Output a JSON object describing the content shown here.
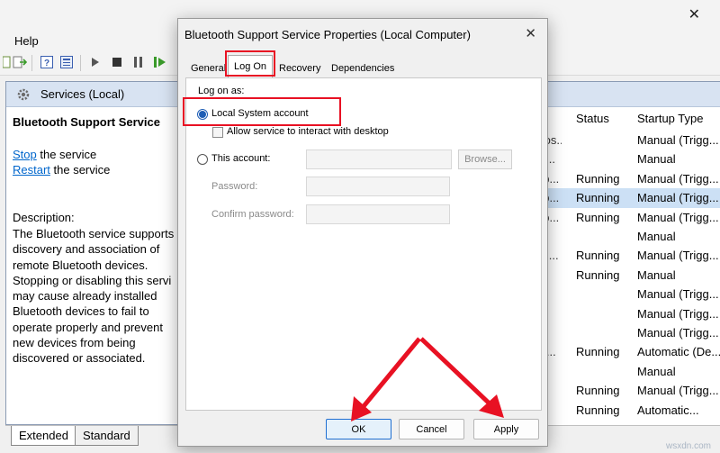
{
  "menu": {
    "help": "Help"
  },
  "left_pane": {
    "header": "Services (Local)",
    "service_name": "Bluetooth Support Service",
    "stop_link": "Stop",
    "stop_rest": " the service",
    "restart_link": "Restart",
    "restart_rest": " the service",
    "description_label": "Description:",
    "description_lines": [
      "The Bluetooth service supports",
      "discovery and association of",
      "remote Bluetooth devices.",
      "Stopping or disabling this servi",
      "may cause already installed",
      "Bluetooth devices to fail to",
      "operate properly and prevent",
      "new devices from being",
      "discovered or associated."
    ]
  },
  "services_list": {
    "headers": {
      "name_fragment": "n",
      "status": "Status",
      "startup": "Startup Type"
    },
    "rows": [
      {
        "frag": "Pos...",
        "status": "",
        "startup": "Manual (Trigg..."
      },
      {
        "frag": "G...",
        "status": "",
        "startup": "Manual"
      },
      {
        "frag": "pp...",
        "status": "Running",
        "startup": "Manual (Trigg..."
      },
      {
        "frag": "oo...",
        "status": "Running",
        "startup": "Manual (Trigg...",
        "selected": true
      },
      {
        "frag": "po...",
        "status": "Running",
        "startup": "Manual (Trigg..."
      },
      {
        "frag": "...",
        "status": "",
        "startup": "Manual"
      },
      {
        "frag": "rvi...",
        "status": "Running",
        "startup": "Manual (Trigg..."
      },
      {
        "frag": "...",
        "status": "Running",
        "startup": "Manual"
      },
      {
        "frag": "...",
        "status": "",
        "startup": "Manual (Trigg..."
      },
      {
        "frag": "...",
        "status": "",
        "startup": "Manual (Trigg..."
      },
      {
        "frag": "...",
        "status": "",
        "startup": "Manual (Trigg..."
      },
      {
        "frag": "er...",
        "status": "Running",
        "startup": "Automatic (De..."
      },
      {
        "frag": "...",
        "status": "",
        "startup": "Manual"
      },
      {
        "frag": "...",
        "status": "Running",
        "startup": "Manual (Trigg..."
      },
      {
        "frag": "...",
        "status": "Running",
        "startup": "Automatic..."
      }
    ]
  },
  "bottom_tabs": {
    "extended": "Extended",
    "standard": "Standard"
  },
  "dialog": {
    "title": "Bluetooth Support Service Properties (Local Computer)",
    "tabs": [
      "General",
      "Log On",
      "Recovery",
      "Dependencies"
    ],
    "active_tab": "Log On",
    "log_on_as": "Log on as:",
    "local_system": "Local System account",
    "allow_interact": "Allow service to interact with desktop",
    "this_account": "This account:",
    "browse": "Browse...",
    "password": "Password:",
    "confirm_password": "Confirm password:",
    "buttons": {
      "ok": "OK",
      "cancel": "Cancel",
      "apply": "Apply"
    }
  },
  "annotation_color": "#e81123",
  "watermark": "wsxdn.com"
}
